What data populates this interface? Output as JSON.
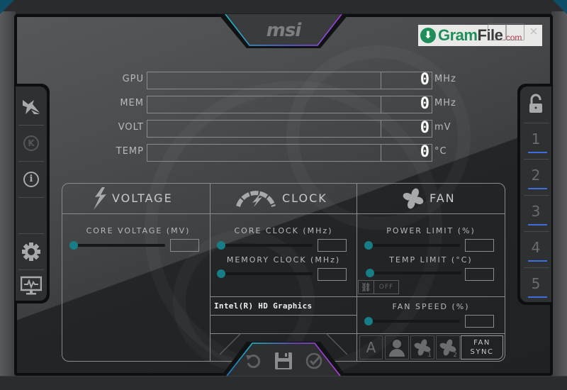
{
  "app": {
    "brand": "msi",
    "watermark": {
      "prefix": "Gram",
      "suffix": "File",
      "domain": ".com"
    },
    "window_controls": {
      "close_glyph": "×"
    }
  },
  "monitor": [
    {
      "label": "GPU",
      "value": "0",
      "unit": "MHz"
    },
    {
      "label": "MEM",
      "value": "0",
      "unit": "MHz"
    },
    {
      "label": "VOLT",
      "value": "0",
      "unit": "mV"
    },
    {
      "label": "TEMP",
      "value": "0",
      "unit": "°C"
    }
  ],
  "sidebar_left": {
    "items": [
      {
        "id": "oc-scanner",
        "icon": "jet-icon"
      },
      {
        "id": "kombustor",
        "icon": "k-circle-icon",
        "glyph": "K"
      },
      {
        "id": "info",
        "icon": "info-icon",
        "glyph": "i"
      },
      {
        "id": "empty",
        "icon": ""
      },
      {
        "id": "settings",
        "icon": "gear-icon"
      },
      {
        "id": "monitoring",
        "icon": "monitor-icon"
      }
    ]
  },
  "sidebar_right": {
    "lock_icon": "unlock-icon",
    "profiles": [
      {
        "label": "1"
      },
      {
        "label": "2"
      },
      {
        "label": "3"
      },
      {
        "label": "4"
      },
      {
        "label": "5"
      }
    ],
    "accent": "#3b6fe0"
  },
  "sections": {
    "voltage": {
      "title": "VOLTAGE",
      "controls": [
        {
          "label": "CORE VOLTAGE  (MV)",
          "value": ""
        }
      ]
    },
    "clock": {
      "title": "CLOCK",
      "controls": [
        {
          "label": "CORE CLOCK (MHz)",
          "value": ""
        },
        {
          "label": "MEMORY CLOCK (MHz)",
          "value": ""
        }
      ],
      "gpu_name": "Intel(R) HD Graphics"
    },
    "fan": {
      "title": "FAN",
      "controls": [
        {
          "label": "POWER LIMIT (%)",
          "value": ""
        },
        {
          "label": "TEMP LIMIT (°C)",
          "value": ""
        },
        {
          "label": "FAN SPEED (%)",
          "value": ""
        }
      ],
      "link_toggle": {
        "state": "OFF"
      },
      "buttons": [
        {
          "id": "auto",
          "label": "A"
        },
        {
          "id": "user",
          "icon": "user-icon"
        },
        {
          "id": "fan1",
          "icon": "fan-icon",
          "sub": "1"
        },
        {
          "id": "fan2",
          "icon": "fan-icon",
          "sub": "2"
        }
      ],
      "sync": {
        "line1": "FAN",
        "line2": "SYNC"
      }
    }
  },
  "actions": [
    {
      "id": "reset",
      "icon": "reset-icon"
    },
    {
      "id": "save",
      "icon": "save-icon"
    },
    {
      "id": "apply",
      "icon": "apply-check-icon"
    }
  ],
  "colors": {
    "slider_knob": "#177e85",
    "profile_underline": "#3b6fe0",
    "rgb_start": "#19c2c9",
    "rgb_end": "#a63be6"
  }
}
